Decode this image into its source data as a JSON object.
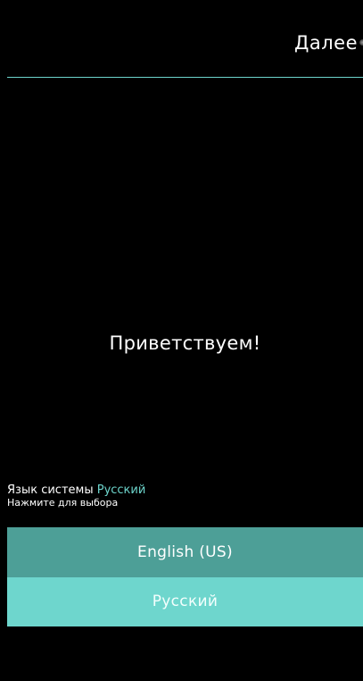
{
  "header": {
    "next_label": "Далее"
  },
  "welcome": {
    "title": "Приветствуем!"
  },
  "system_language": {
    "label": "Язык системы",
    "value": "Русский",
    "hint": "Нажмите для выбора"
  },
  "languages": [
    {
      "label": "English (US)",
      "selected": false
    },
    {
      "label": "Русский",
      "selected": true
    }
  ],
  "colors": {
    "background": "#000000",
    "accent": "#6dd5cc",
    "option_dark": "#4d9f97",
    "option_light": "#6ed6cd",
    "text": "#ffffff"
  }
}
